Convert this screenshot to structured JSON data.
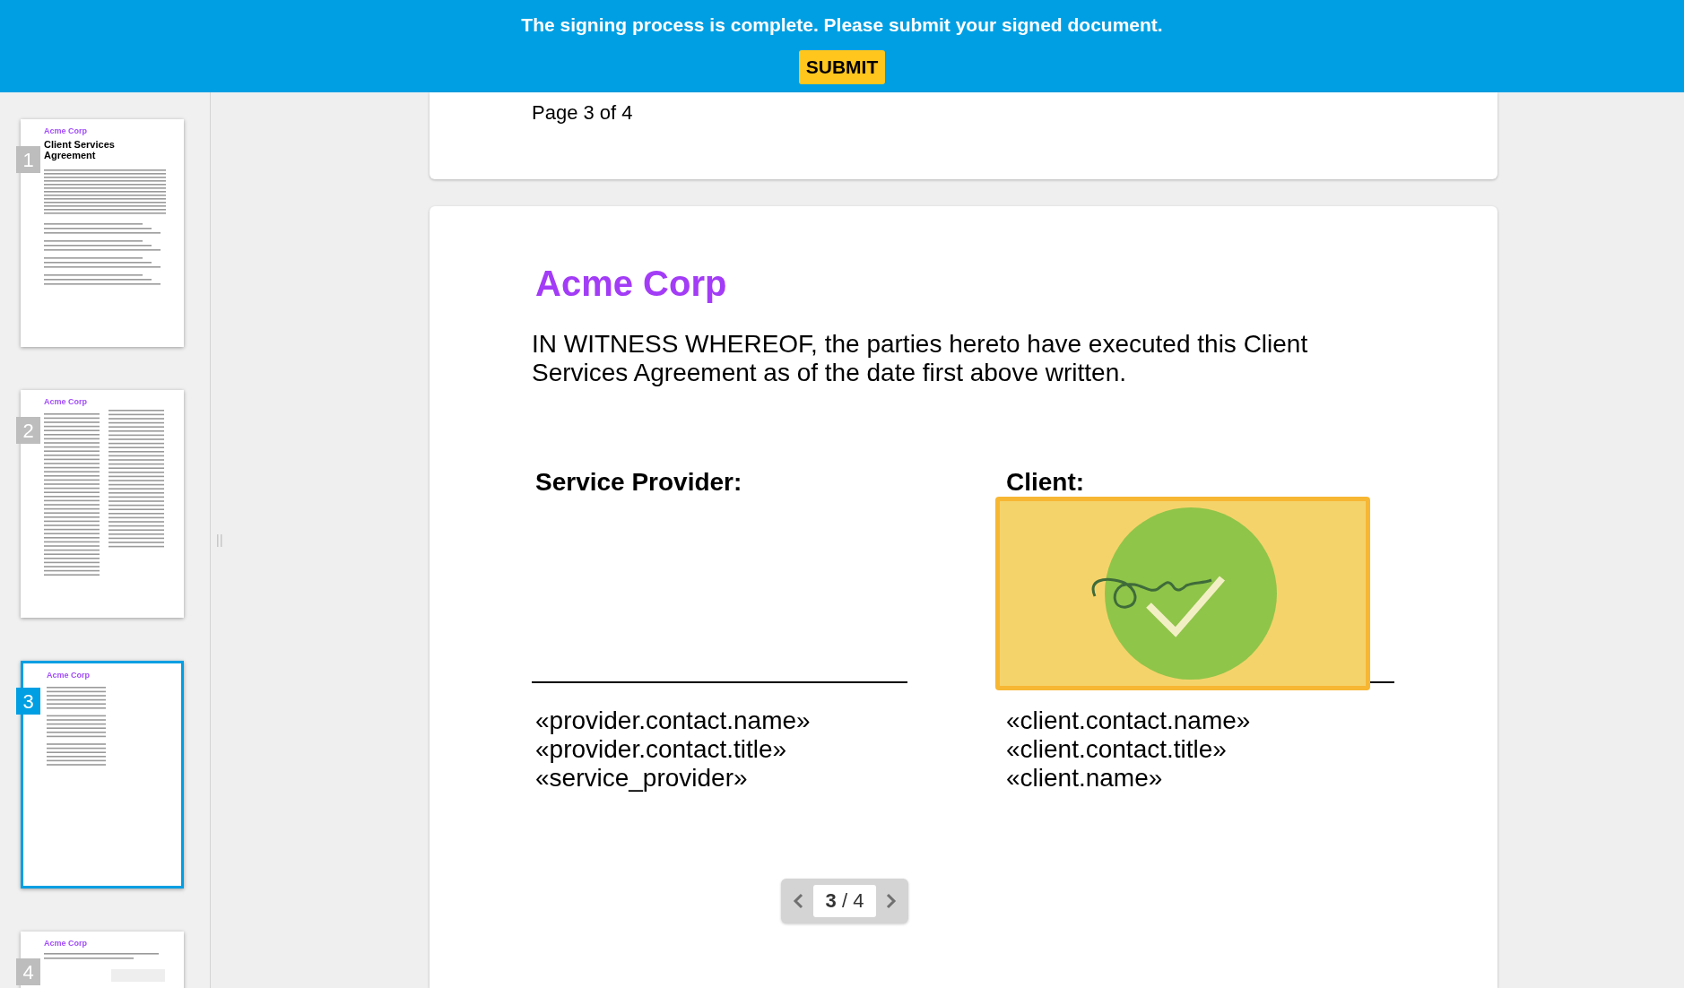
{
  "banner": {
    "message": "The signing process is complete. Please submit your signed document.",
    "submit_button": "SUBMIT"
  },
  "thumbnails": [
    {
      "number": "1",
      "selected": false,
      "heading": "Acme Corp",
      "title": "Client Services Agreement",
      "kind": "cover"
    },
    {
      "number": "2",
      "selected": false,
      "heading": "Acme Corp",
      "kind": "two_column"
    },
    {
      "number": "3",
      "selected": true,
      "heading": "Acme Corp",
      "kind": "short"
    },
    {
      "number": "4",
      "selected": false,
      "heading": "Acme Corp",
      "kind": "signature"
    }
  ],
  "previous_page": {
    "footer": "Page 3 of 4"
  },
  "page": {
    "company": "Acme Corp",
    "statement": "IN WITNESS WHEREOF, the parties hereto have executed this Client Services Agreement as of the date first above written.",
    "signatures": [
      {
        "heading": "Service Provider:",
        "signed": false,
        "lines": [
          "«provider.contact.name»",
          "«provider.contact.title»",
          "«service_provider»"
        ]
      },
      {
        "heading": "Client:",
        "signed": true,
        "lines": [
          "«client.contact.name»",
          "«client.contact.title»",
          "«client.name»"
        ]
      }
    ]
  },
  "pager": {
    "label": "**3** / 4"
  }
}
